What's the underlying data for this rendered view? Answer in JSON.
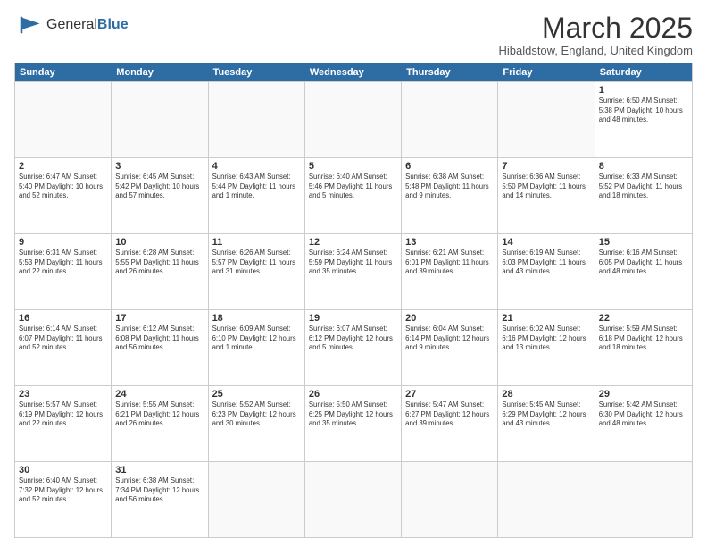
{
  "logo": {
    "general": "General",
    "blue": "Blue"
  },
  "header": {
    "title": "March 2025",
    "subtitle": "Hibaldstow, England, United Kingdom"
  },
  "days_of_week": [
    "Sunday",
    "Monday",
    "Tuesday",
    "Wednesday",
    "Thursday",
    "Friday",
    "Saturday"
  ],
  "weeks": [
    [
      {
        "day": "",
        "info": "",
        "empty": true
      },
      {
        "day": "",
        "info": "",
        "empty": true
      },
      {
        "day": "",
        "info": "",
        "empty": true
      },
      {
        "day": "",
        "info": "",
        "empty": true
      },
      {
        "day": "",
        "info": "",
        "empty": true
      },
      {
        "day": "",
        "info": "",
        "empty": true
      },
      {
        "day": "1",
        "info": "Sunrise: 6:50 AM\nSunset: 5:38 PM\nDaylight: 10 hours and 48 minutes."
      }
    ],
    [
      {
        "day": "2",
        "info": "Sunrise: 6:47 AM\nSunset: 5:40 PM\nDaylight: 10 hours and 52 minutes."
      },
      {
        "day": "3",
        "info": "Sunrise: 6:45 AM\nSunset: 5:42 PM\nDaylight: 10 hours and 57 minutes."
      },
      {
        "day": "4",
        "info": "Sunrise: 6:43 AM\nSunset: 5:44 PM\nDaylight: 11 hours and 1 minute."
      },
      {
        "day": "5",
        "info": "Sunrise: 6:40 AM\nSunset: 5:46 PM\nDaylight: 11 hours and 5 minutes."
      },
      {
        "day": "6",
        "info": "Sunrise: 6:38 AM\nSunset: 5:48 PM\nDaylight: 11 hours and 9 minutes."
      },
      {
        "day": "7",
        "info": "Sunrise: 6:36 AM\nSunset: 5:50 PM\nDaylight: 11 hours and 14 minutes."
      },
      {
        "day": "8",
        "info": "Sunrise: 6:33 AM\nSunset: 5:52 PM\nDaylight: 11 hours and 18 minutes."
      }
    ],
    [
      {
        "day": "9",
        "info": "Sunrise: 6:31 AM\nSunset: 5:53 PM\nDaylight: 11 hours and 22 minutes."
      },
      {
        "day": "10",
        "info": "Sunrise: 6:28 AM\nSunset: 5:55 PM\nDaylight: 11 hours and 26 minutes."
      },
      {
        "day": "11",
        "info": "Sunrise: 6:26 AM\nSunset: 5:57 PM\nDaylight: 11 hours and 31 minutes."
      },
      {
        "day": "12",
        "info": "Sunrise: 6:24 AM\nSunset: 5:59 PM\nDaylight: 11 hours and 35 minutes."
      },
      {
        "day": "13",
        "info": "Sunrise: 6:21 AM\nSunset: 6:01 PM\nDaylight: 11 hours and 39 minutes."
      },
      {
        "day": "14",
        "info": "Sunrise: 6:19 AM\nSunset: 6:03 PM\nDaylight: 11 hours and 43 minutes."
      },
      {
        "day": "15",
        "info": "Sunrise: 6:16 AM\nSunset: 6:05 PM\nDaylight: 11 hours and 48 minutes."
      }
    ],
    [
      {
        "day": "16",
        "info": "Sunrise: 6:14 AM\nSunset: 6:07 PM\nDaylight: 11 hours and 52 minutes."
      },
      {
        "day": "17",
        "info": "Sunrise: 6:12 AM\nSunset: 6:08 PM\nDaylight: 11 hours and 56 minutes."
      },
      {
        "day": "18",
        "info": "Sunrise: 6:09 AM\nSunset: 6:10 PM\nDaylight: 12 hours and 1 minute."
      },
      {
        "day": "19",
        "info": "Sunrise: 6:07 AM\nSunset: 6:12 PM\nDaylight: 12 hours and 5 minutes."
      },
      {
        "day": "20",
        "info": "Sunrise: 6:04 AM\nSunset: 6:14 PM\nDaylight: 12 hours and 9 minutes."
      },
      {
        "day": "21",
        "info": "Sunrise: 6:02 AM\nSunset: 6:16 PM\nDaylight: 12 hours and 13 minutes."
      },
      {
        "day": "22",
        "info": "Sunrise: 5:59 AM\nSunset: 6:18 PM\nDaylight: 12 hours and 18 minutes."
      }
    ],
    [
      {
        "day": "23",
        "info": "Sunrise: 5:57 AM\nSunset: 6:19 PM\nDaylight: 12 hours and 22 minutes."
      },
      {
        "day": "24",
        "info": "Sunrise: 5:55 AM\nSunset: 6:21 PM\nDaylight: 12 hours and 26 minutes."
      },
      {
        "day": "25",
        "info": "Sunrise: 5:52 AM\nSunset: 6:23 PM\nDaylight: 12 hours and 30 minutes."
      },
      {
        "day": "26",
        "info": "Sunrise: 5:50 AM\nSunset: 6:25 PM\nDaylight: 12 hours and 35 minutes."
      },
      {
        "day": "27",
        "info": "Sunrise: 5:47 AM\nSunset: 6:27 PM\nDaylight: 12 hours and 39 minutes."
      },
      {
        "day": "28",
        "info": "Sunrise: 5:45 AM\nSunset: 6:29 PM\nDaylight: 12 hours and 43 minutes."
      },
      {
        "day": "29",
        "info": "Sunrise: 5:42 AM\nSunset: 6:30 PM\nDaylight: 12 hours and 48 minutes."
      }
    ],
    [
      {
        "day": "30",
        "info": "Sunrise: 6:40 AM\nSunset: 7:32 PM\nDaylight: 12 hours and 52 minutes."
      },
      {
        "day": "31",
        "info": "Sunrise: 6:38 AM\nSunset: 7:34 PM\nDaylight: 12 hours and 56 minutes."
      },
      {
        "day": "",
        "info": "",
        "empty": true
      },
      {
        "day": "",
        "info": "",
        "empty": true
      },
      {
        "day": "",
        "info": "",
        "empty": true
      },
      {
        "day": "",
        "info": "",
        "empty": true
      },
      {
        "day": "",
        "info": "",
        "empty": true
      }
    ]
  ]
}
